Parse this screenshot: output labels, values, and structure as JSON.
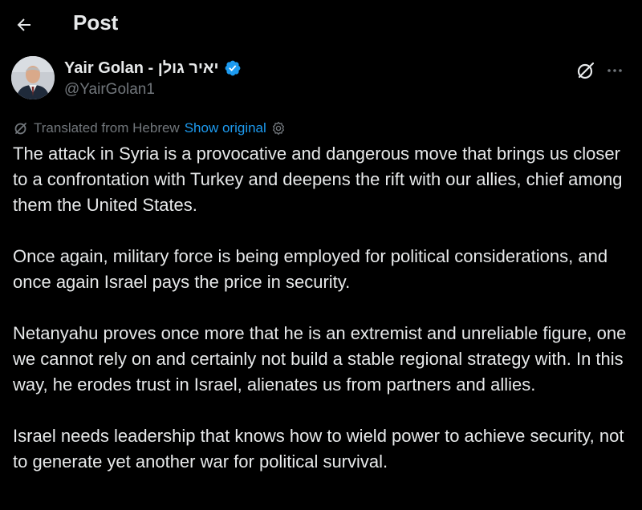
{
  "header": {
    "title": "Post",
    "back_icon": "arrow-left-icon"
  },
  "author": {
    "display_name": "Yair Golan - יאיר גולן",
    "handle": "@YairGolan1",
    "verified_color": "#1d9bf0",
    "icons": [
      "verified-badge-icon",
      "grok-icon",
      "more-icon"
    ]
  },
  "translation": {
    "label": "Translated from Hebrew",
    "show_original": "Show original",
    "icons": [
      "translate-icon",
      "gear-icon"
    ]
  },
  "post": {
    "paragraphs": [
      "The attack in Syria is a provocative and dangerous move that brings us closer to a confrontation with Turkey and deepens the rift with our allies, chief among them the United States.",
      "Once again, military force is being employed for political considerations, and once again Israel pays the price in security.",
      "Netanyahu proves once more that he is an extremist and unreliable figure, one we cannot rely on and certainly not build a stable regional strategy with. In this way, he erodes trust in Israel, alienates us from partners and allies.",
      "Israel needs leadership that knows how to wield power to achieve security, not to generate yet another war for political survival."
    ]
  },
  "colors": {
    "background": "#000000",
    "text": "#e7e9ea",
    "secondary": "#71767b",
    "accent": "#1d9bf0"
  }
}
